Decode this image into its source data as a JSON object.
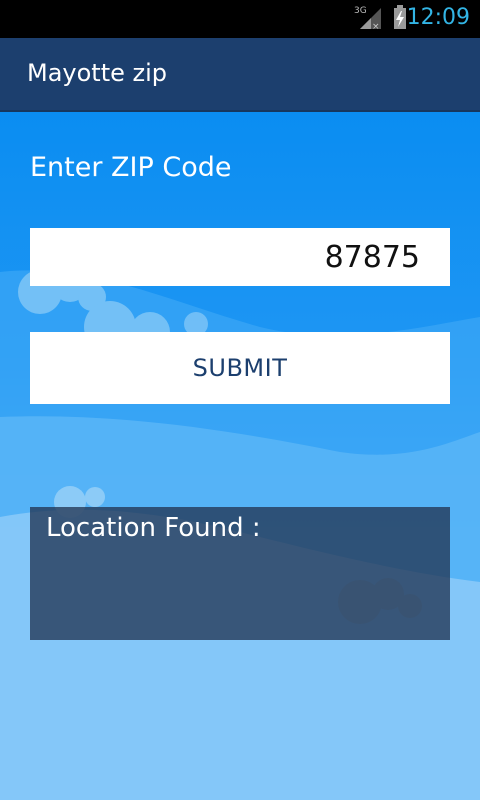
{
  "status_bar": {
    "network": "3G",
    "time": "12:09",
    "icons": [
      "signal-3g-icon",
      "battery-charging-icon"
    ],
    "accent_color": "#33b5e5"
  },
  "action_bar": {
    "title": "Mayotte zip",
    "background": "#1c3f6e"
  },
  "form": {
    "label": "Enter ZIP  Code",
    "zip_value": "87875",
    "submit_label": "SUBMIT"
  },
  "result": {
    "label": "Location Found :",
    "value": ""
  },
  "colors": {
    "sky_top": "#0a8df2",
    "sky_bottom": "#9fd2fb"
  }
}
